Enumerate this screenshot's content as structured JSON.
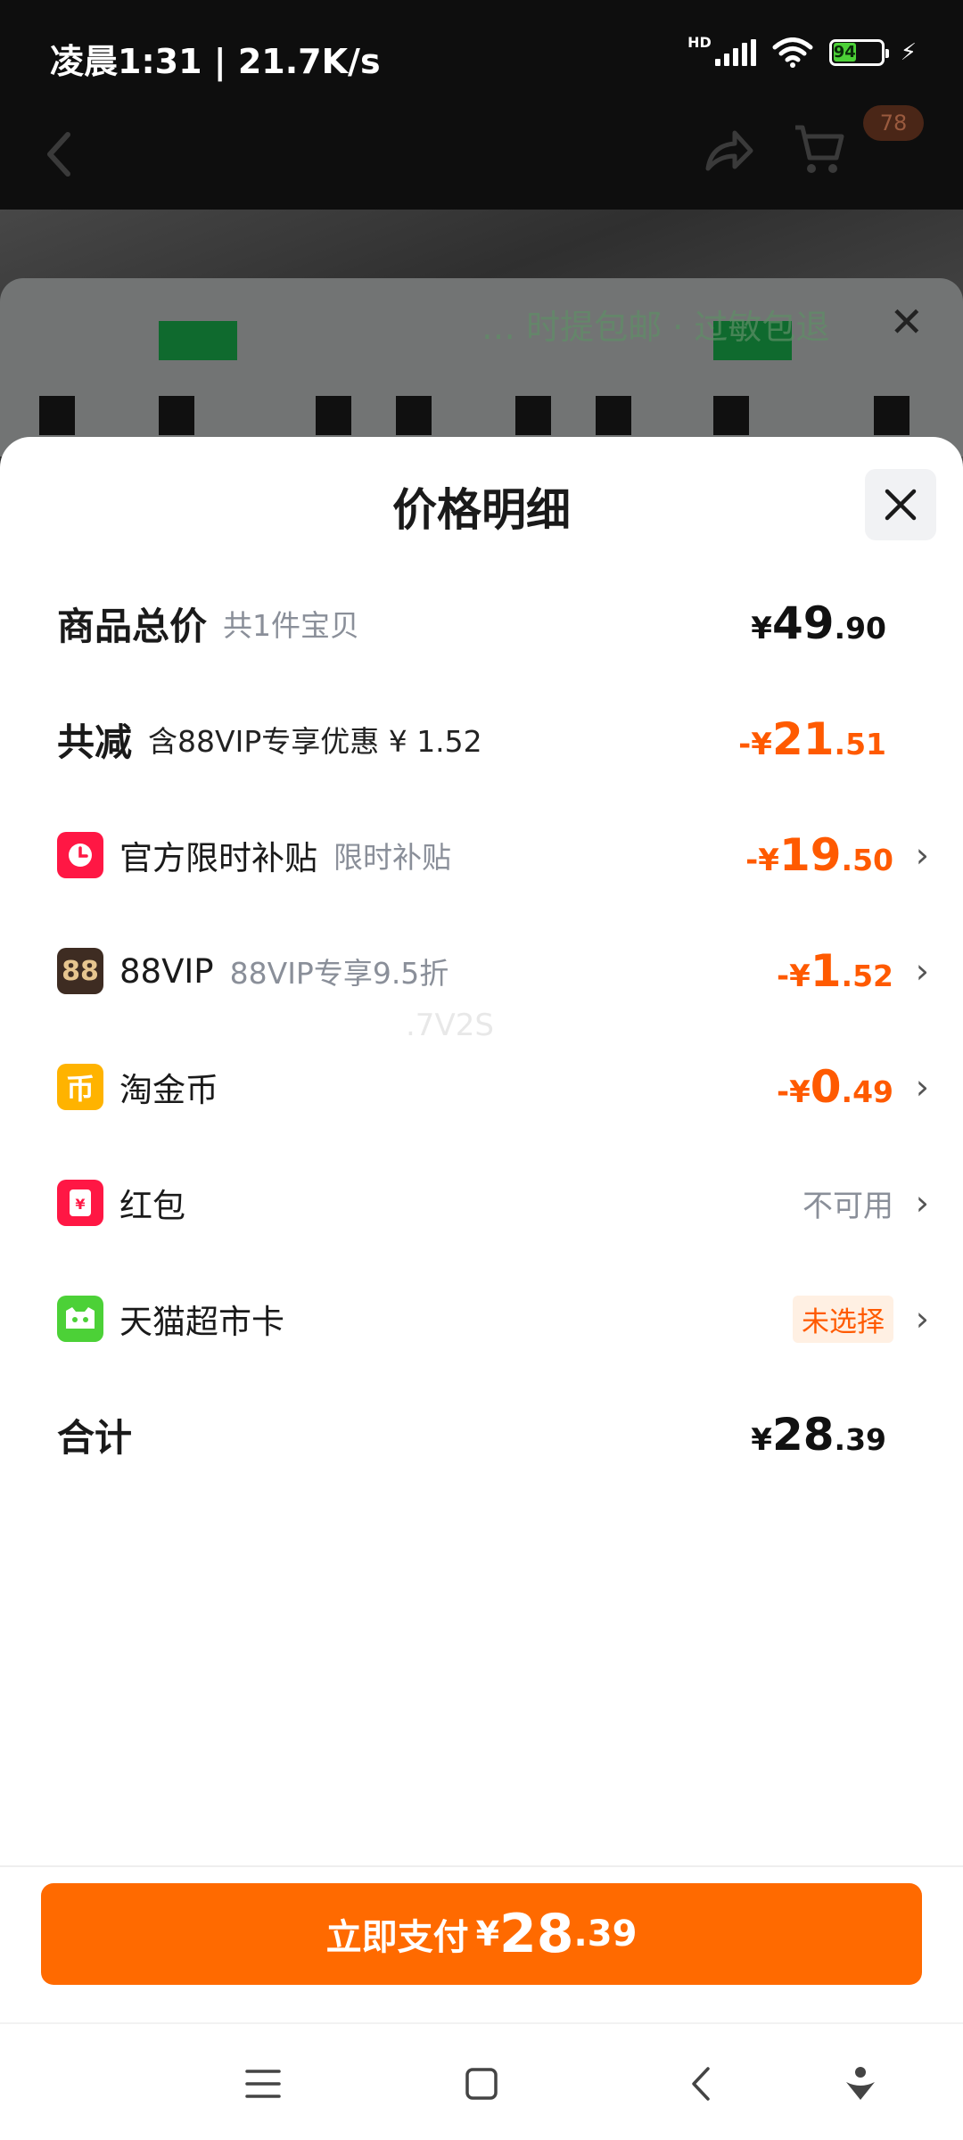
{
  "status_bar": {
    "time": "凌晨1:31 | 21.7K/s",
    "hd": "HD",
    "battery": "94"
  },
  "background": {
    "cart_badge": "78",
    "card_text": "… 时提包邮 · 过敏包退"
  },
  "sheet": {
    "title": "价格明细",
    "rows": [
      {
        "title": "商品总价",
        "sub": "共1件宝贝",
        "sym": "¥",
        "int": "49",
        "dec": ".90"
      },
      {
        "title": "共减",
        "sub": "含88VIP专享优惠 ¥ 1.52",
        "sym": "-¥",
        "int": "21",
        "dec": ".51"
      },
      {
        "label": "官方限时补贴",
        "sub": "限时补贴",
        "sym": "-¥",
        "int": "19",
        "dec": ".50",
        "icon": "clock-icon"
      },
      {
        "label": "88VIP",
        "sub": "88VIP专享9.5折",
        "sym": "-¥",
        "int": "1",
        "dec": ".52",
        "icon": "88vip-icon",
        "icon_text": "88"
      },
      {
        "label": "淘金币",
        "sym": "-¥",
        "int": "0",
        "dec": ".49",
        "icon": "coin-icon",
        "icon_text": "币"
      },
      {
        "label": "红包",
        "status": "不可用",
        "icon": "red-packet-icon"
      },
      {
        "label": "天猫超市卡",
        "status": "未选择",
        "icon": "tmall-card-icon"
      },
      {
        "title": "合计",
        "sym": "¥",
        "int": "28",
        "dec": ".39"
      }
    ],
    "watermark": ".7V2S"
  },
  "pay": {
    "label": "立即支付",
    "sym": "¥",
    "int": "28",
    "dec": ".39"
  },
  "colors": {
    "accent": "#ff6a00",
    "discount": "#ff5a00",
    "text": "#1a1a1a",
    "muted": "#8a8f99"
  }
}
